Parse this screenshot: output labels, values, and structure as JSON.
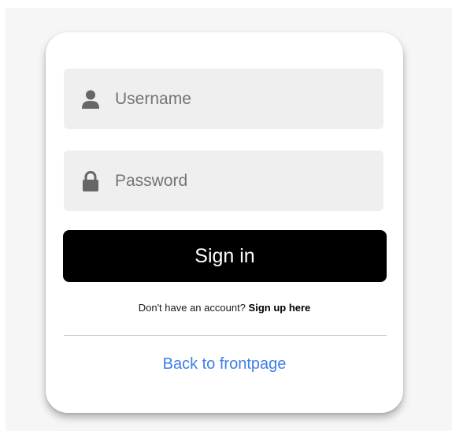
{
  "login_form": {
    "username": {
      "placeholder": "Username",
      "value": "",
      "icon": "person-icon"
    },
    "password": {
      "placeholder": "Password",
      "value": "",
      "icon": "lock-icon"
    },
    "signin_label": "Sign in",
    "signup_prompt": "Don't have an account?",
    "signup_link": "Sign up here",
    "back_link": "Back to frontpage"
  },
  "colors": {
    "button_bg": "#000000",
    "field_bg": "#efefef",
    "link": "#3f7fe8",
    "icon": "#666666"
  }
}
